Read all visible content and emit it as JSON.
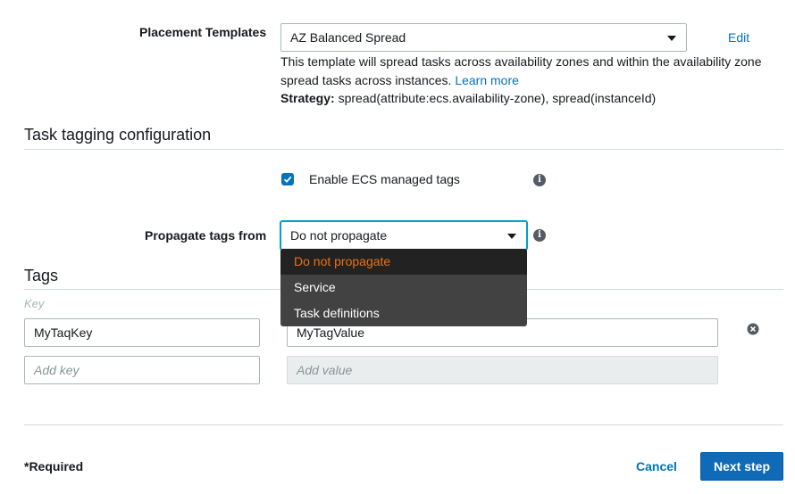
{
  "placement": {
    "label": "Placement Templates",
    "selected": "AZ Balanced Spread",
    "edit_label": "Edit",
    "description": "This template will spread tasks across availability zones and within the availability zone spread tasks across instances.",
    "learn_more": "Learn more",
    "strategy_label": "Strategy:",
    "strategy_value": "spread(attribute:ecs.availability-zone), spread(instanceId)"
  },
  "task_tagging": {
    "title": "Task tagging configuration",
    "enable_label": "Enable ECS managed tags",
    "enable_checked": true,
    "propagate_label": "Propagate tags from",
    "propagate_selected": "Do not propagate",
    "propagate_options": [
      "Do not propagate",
      "Service",
      "Task definitions"
    ]
  },
  "tags": {
    "title": "Tags",
    "key_header": "Key",
    "rows": [
      {
        "key": "MyTaqKey",
        "value": "MyTagValue"
      }
    ],
    "new_row": {
      "key_placeholder": "Add key",
      "value_placeholder": "Add value"
    }
  },
  "footer": {
    "required_note": "*Required",
    "cancel_label": "Cancel",
    "next_label": "Next step"
  },
  "colors": {
    "accent": "#0073bb",
    "primary_button": "#0f6ab8",
    "selected_option": "#ec7211"
  }
}
